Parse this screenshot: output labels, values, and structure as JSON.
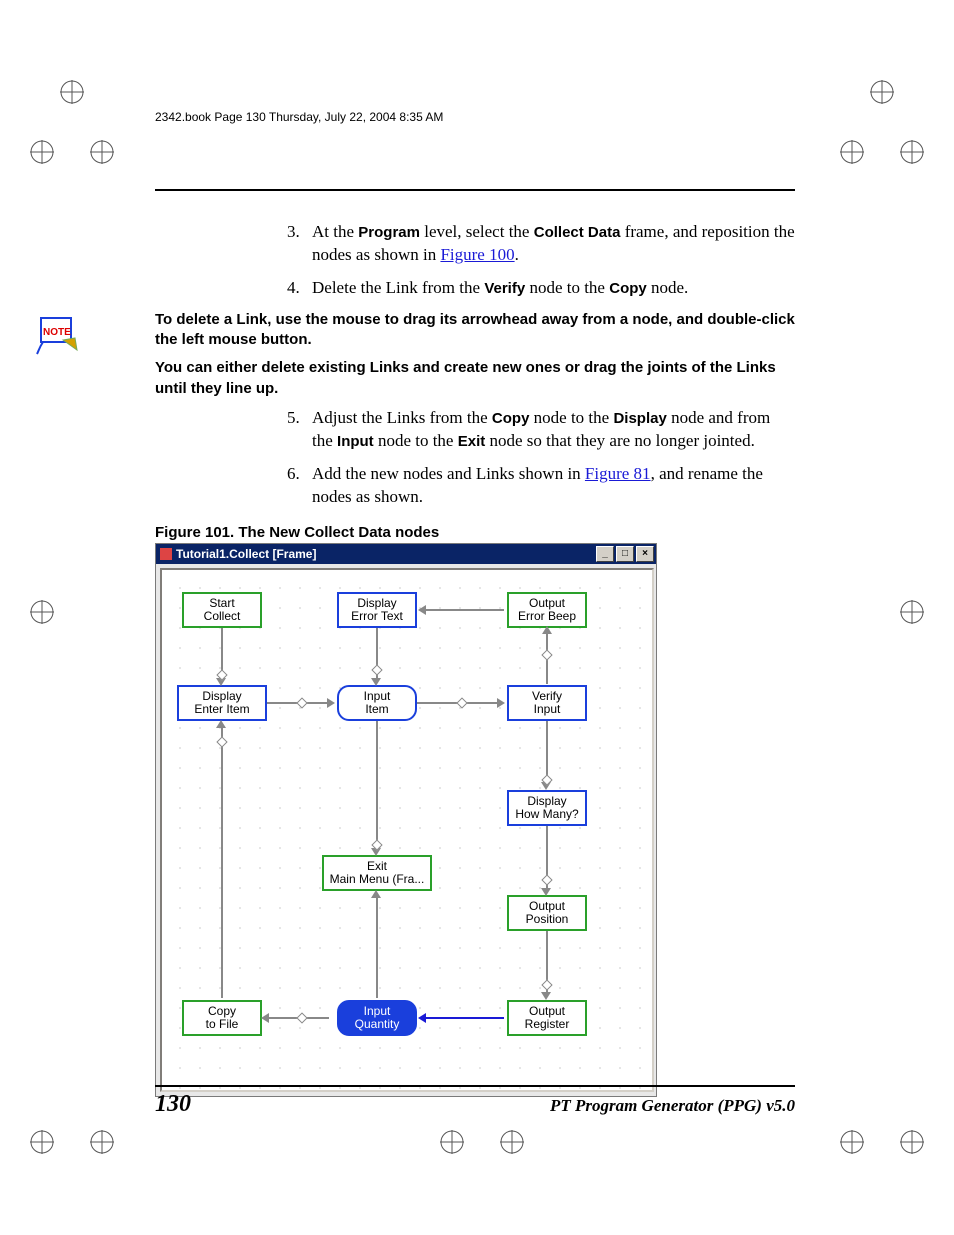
{
  "header": {
    "crop_text": "2342.book  Page 130  Thursday, July 22, 2004  8:35 AM"
  },
  "steps": {
    "s3_pre": "At the ",
    "s3_term1": "Program",
    "s3_mid1": " level, select the ",
    "s3_term2": "Collect Data",
    "s3_mid2": " frame, and reposition the nodes as shown in ",
    "s3_link": "Figure 100",
    "s3_post": ".",
    "s4_pre": "Delete the Link from the ",
    "s4_term1": "Verify",
    "s4_mid": " node to the ",
    "s4_term2": "Copy",
    "s4_post": " node.",
    "note1": "To delete a Link, use the mouse to drag its arrowhead away from a node, and double-click the left mouse button.",
    "note2": "You can either delete existing Links and create new ones or drag the joints of the Links until they line up.",
    "s5_pre": "Adjust the Links from the ",
    "s5_t1": "Copy",
    "s5_m1": " node to the ",
    "s5_t2": "Display",
    "s5_m2": " node and from the ",
    "s5_t3": "Input",
    "s5_m3": " node to the ",
    "s5_t4": "Exit",
    "s5_post": " node so that they are no longer jointed.",
    "s6_pre": "Add the new nodes and Links shown in ",
    "s6_link": "Figure 81",
    "s6_post": ", and rename the nodes as shown."
  },
  "figure": {
    "caption": "Figure 101. The New Collect Data nodes",
    "title": "Tutorial1.Collect [Frame]",
    "min": "_",
    "max": "□",
    "close": "×",
    "nodes": {
      "n_start_l1": "Start",
      "n_start_l2": "Collect",
      "n_derr_l1": "Display",
      "n_derr_l2": "Error Text",
      "n_obeep_l1": "Output",
      "n_obeep_l2": "Error Beep",
      "n_dent_l1": "Display",
      "n_dent_l2": "Enter Item",
      "n_initem_l1": "Input",
      "n_initem_l2": "Item",
      "n_ver_l1": "Verify",
      "n_ver_l2": "Input",
      "n_dhow_l1": "Display",
      "n_dhow_l2": "How Many?",
      "n_exit_l1": "Exit",
      "n_exit_l2": "Main Menu (Fra...",
      "n_opos_l1": "Output",
      "n_opos_l2": "Position",
      "n_copy_l1": "Copy",
      "n_copy_l2": "to File",
      "n_inqty_l1": "Input",
      "n_inqty_l2": "Quantity",
      "n_oreg_l1": "Output",
      "n_oreg_l2": "Register"
    }
  },
  "footer": {
    "page": "130",
    "title": "PT Program Generator (PPG)  v5.0"
  }
}
